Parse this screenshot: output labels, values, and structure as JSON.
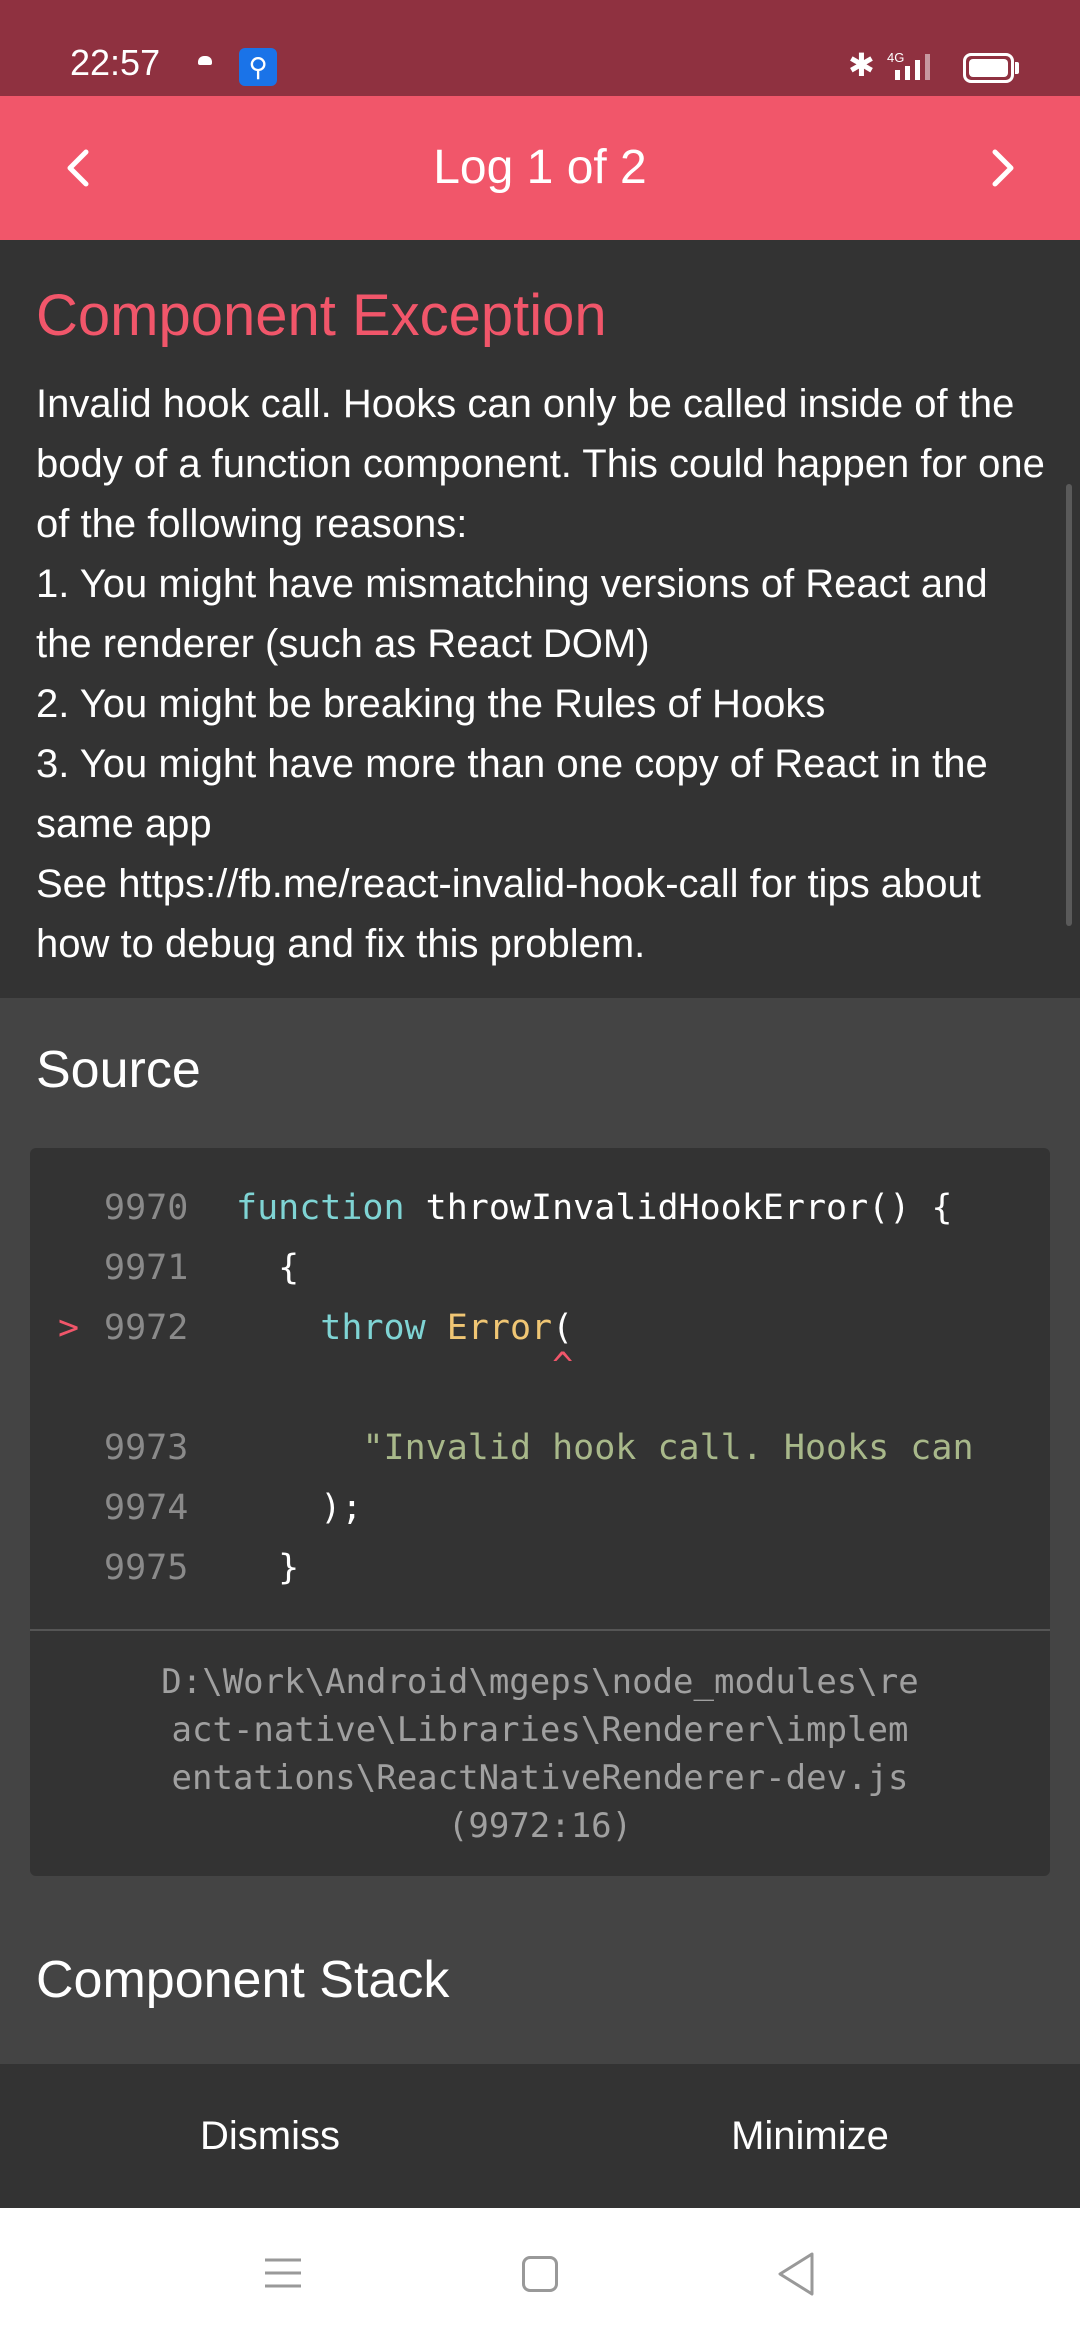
{
  "status_bar": {
    "time": "22:57",
    "network": "4G",
    "icons": [
      "cloud-icon",
      "usb-icon",
      "bluetooth-icon",
      "signal-icon",
      "battery-icon"
    ]
  },
  "header": {
    "title": "Log 1 of 2",
    "prev_icon": "chevron-left-icon",
    "next_icon": "chevron-right-icon",
    "background_color": "#f1566a"
  },
  "message": {
    "title": "Component Exception",
    "title_color": "#f1566a",
    "text": "Invalid hook call. Hooks can only be called inside of the body of a function component. This could happen for one of the following reasons:\n1. You might have mismatching versions of React and the renderer (such as React DOM)\n2. You might be breaking the Rules of Hooks\n3. You might have more than one copy of React in the same app\nSee https://fb.me/react-invalid-hook-call for tips about how to debug and fix this problem."
  },
  "source": {
    "heading": "Source",
    "lines": [
      {
        "num": "9970",
        "marker": "",
        "tokens": [
          {
            "t": "function",
            "c": "kw"
          },
          {
            "t": " throwInvalidHookError() {",
            "c": "fn"
          }
        ]
      },
      {
        "num": "9971",
        "marker": "",
        "tokens": [
          {
            "t": "  {",
            "c": "fn"
          }
        ]
      },
      {
        "num": "9972",
        "marker": ">",
        "tokens": [
          {
            "t": "    ",
            "c": "fn"
          },
          {
            "t": "throw",
            "c": "kw"
          },
          {
            "t": " ",
            "c": "fn"
          },
          {
            "t": "Error",
            "c": "err"
          },
          {
            "t": "(",
            "c": "fn"
          }
        ]
      },
      {
        "num": "",
        "marker": "",
        "tokens": [
          {
            "t": "               ^",
            "c": "caret"
          }
        ]
      },
      {
        "num": "9973",
        "marker": "",
        "tokens": [
          {
            "t": "      ",
            "c": "fn"
          },
          {
            "t": "\"Invalid hook call. Hooks can",
            "c": "str"
          }
        ]
      },
      {
        "num": "9974",
        "marker": "",
        "tokens": [
          {
            "t": "    );",
            "c": "fn"
          }
        ]
      },
      {
        "num": "9975",
        "marker": "",
        "tokens": [
          {
            "t": "  }",
            "c": "fn"
          }
        ]
      }
    ],
    "file_path": "D:\\Work\\Android\\mgeps\\node_modules\\re\nact-native\\Libraries\\Renderer\\implem\nentations\\ReactNativeRenderer-dev.js\n(9972:16)"
  },
  "component_stack": {
    "heading": "Component Stack"
  },
  "actions": {
    "dismiss_label": "Dismiss",
    "minimize_label": "Minimize"
  },
  "system_nav": {
    "icons": [
      "menu-icon",
      "home-icon",
      "back-icon"
    ]
  }
}
